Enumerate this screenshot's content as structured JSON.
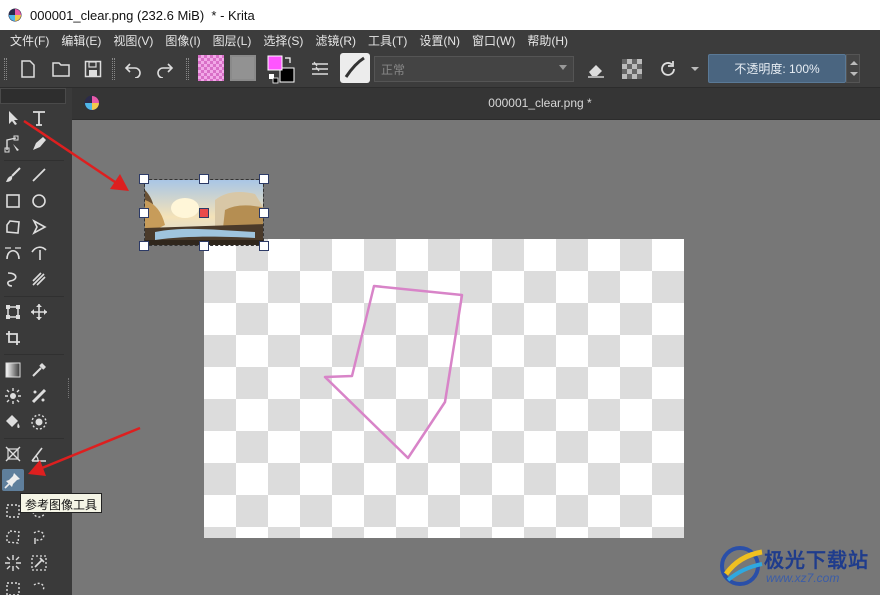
{
  "window": {
    "title": "000001_clear.png (232.6 MiB)  * - Krita"
  },
  "menu": [
    "文件(F)",
    "编辑(E)",
    "视图(V)",
    "图像(I)",
    "图层(L)",
    "选择(S)",
    "滤镜(R)",
    "工具(T)",
    "设置(N)",
    "窗口(W)",
    "帮助(H)"
  ],
  "toolbar": {
    "blend_mode": "正常",
    "opacity_label": "不透明度:  100%",
    "foreground_color": "#ff55ff",
    "background_color": "#000000"
  },
  "document_tab": {
    "label": "000001_clear.png *"
  },
  "toolbox": {
    "tooltip": "参考图像工具"
  },
  "watermark": {
    "brand": "极光下载站",
    "url": "www.xz7.com"
  },
  "colors": {
    "canvas_background": "#777777",
    "active_tool": "#5f7f9c",
    "stroke": "#d884c8",
    "annotation_arrow": "#dd1f1f"
  }
}
